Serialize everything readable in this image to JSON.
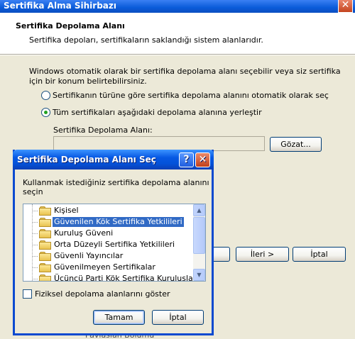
{
  "wizard": {
    "title": "Sertifika Alma Sihirbazı",
    "close_glyph": "✕",
    "header_title": "Sertifika Depolama Alanı",
    "header_subtitle": "Sertifika depoları, sertifikaların saklandığı sistem alanlarıdır.",
    "body_text": "Windows otomatik olarak bir sertifika depolama alanı seçebilir veya siz sertifika için bir konum belirtebilirsiniz.",
    "radio_auto": "Sertifikanın türüne göre sertifika depolama alanını otomatik olarak seç",
    "radio_manual": "Tüm sertifikaları aşağıdaki depolama alanına yerleştir",
    "store_label": "Sertifika Depolama Alanı:",
    "store_value": "",
    "browse_button": "Gözat...",
    "next_button": "İleri >",
    "cancel_button": "İptal",
    "bg_under_text": "Pavlasian Bölümü"
  },
  "dialog": {
    "title": "Sertifika Depolama Alanı Seç",
    "help_glyph": "?",
    "close_glyph": "✕",
    "instruction": "Kullanmak istediğiniz sertifika depolama alanını seçin",
    "tree_items": [
      "Kişisel",
      "Güvenilen Kök Sertifika Yetkilileri",
      "Kuruluş Güveni",
      "Orta Düzeyli Sertifika Yetkilileri",
      "Güvenli Yayıncılar",
      "Güvenilmeyen Sertifikalar",
      "Üçüncü Parti Kök Sertifika Kuruluşları"
    ],
    "selected_index": 1,
    "show_physical_label": "Fiziksel depolama alanlarını göster",
    "ok_button": "Tamam",
    "cancel_button": "İptal"
  },
  "scroll_up_glyph": "▲",
  "scroll_down_glyph": "▼",
  "colors": {
    "selection": "#316ac5",
    "titlebar": "#0a4ad0",
    "window_bg": "#ece9d8"
  }
}
